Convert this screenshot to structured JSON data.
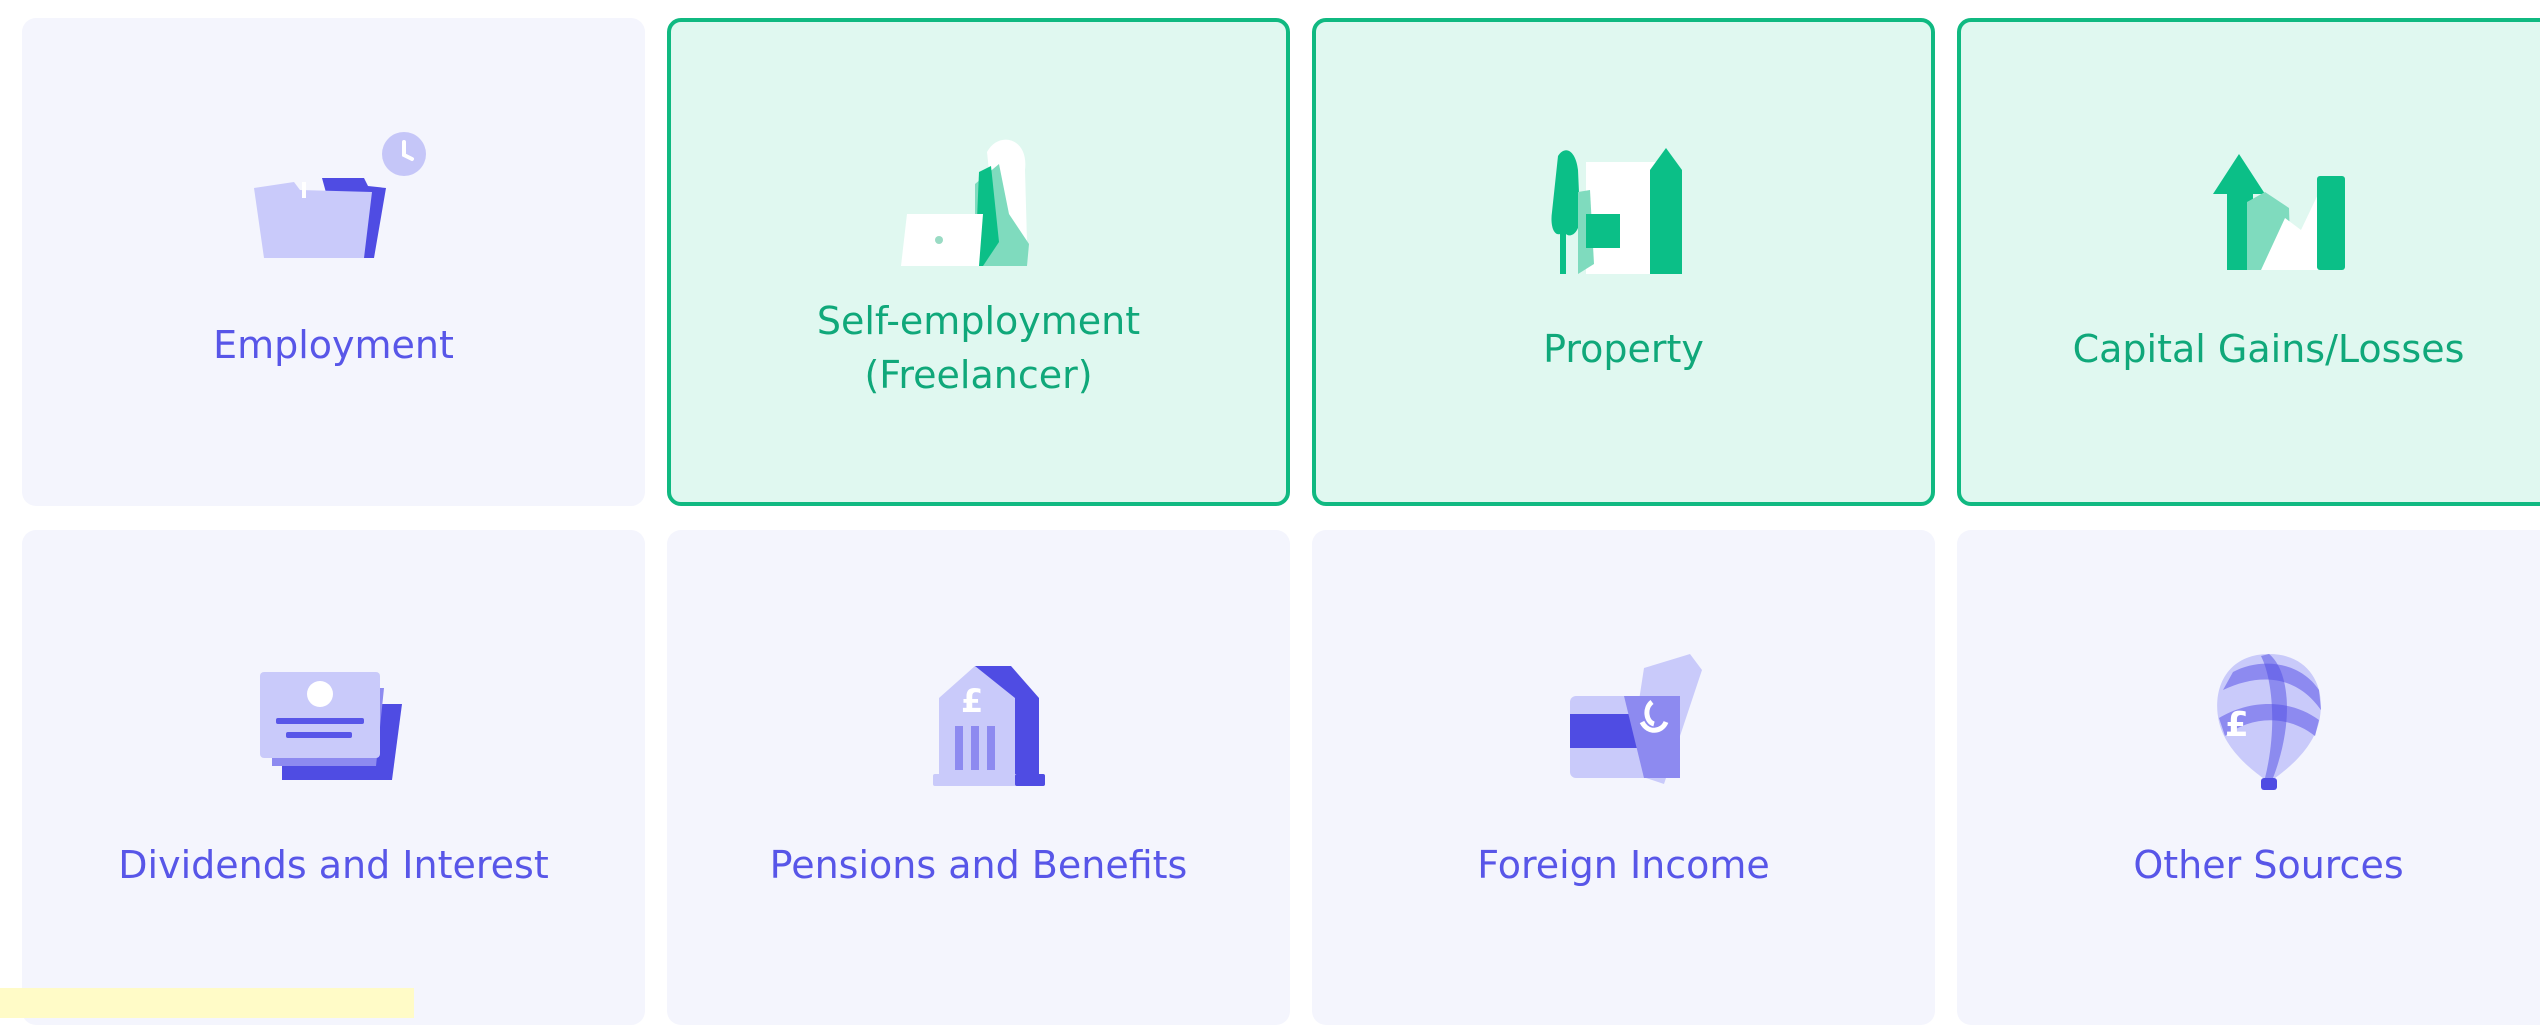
{
  "categories": [
    {
      "label": "Employment",
      "icon": "folder-clock-icon",
      "selected": false
    },
    {
      "label_line1": "Self-employment",
      "label_line2": "(Freelancer)",
      "icon": "freelancer-laptop-icon",
      "selected": true
    },
    {
      "label": "Property",
      "icon": "house-tree-icon",
      "selected": true
    },
    {
      "label": "Capital Gains/Losses",
      "icon": "arrow-up-chart-icon",
      "selected": true
    },
    {
      "label": "Dividends and Interest",
      "icon": "stacked-cards-icon",
      "selected": false
    },
    {
      "label": "Pensions and Benefits",
      "icon": "bank-pound-icon",
      "selected": false
    },
    {
      "label": "Foreign Income",
      "icon": "card-currency-icon",
      "selected": false
    },
    {
      "label": "Other Sources",
      "icon": "balloon-pound-icon",
      "selected": false
    }
  ],
  "colors": {
    "card_bg": "#f4f5fd",
    "selected_bg": "#e0f8f0",
    "selected_border": "#10b981",
    "label_default": "#5856e8",
    "label_selected": "#10a87a"
  }
}
